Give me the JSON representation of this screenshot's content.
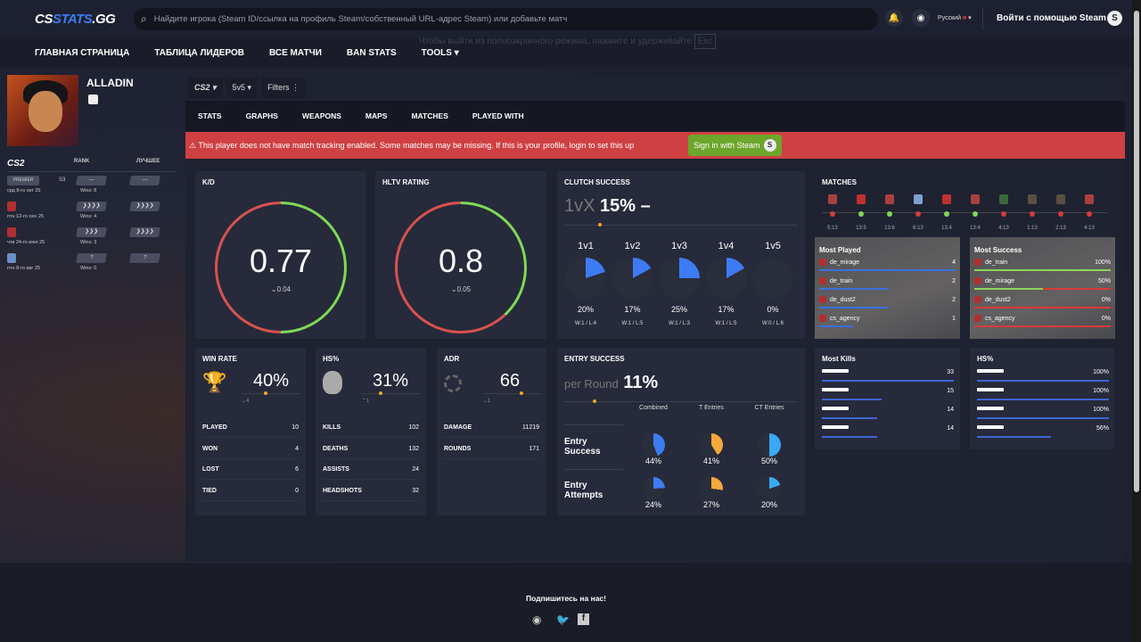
{
  "header": {
    "logo_a": "CS",
    "logo_b": "STATS",
    "logo_c": ".GG",
    "search_placeholder": "Найдите игрока (Steam ID/ссылка на профиль Steam/собственный URL-адрес Steam) или добавьте матч",
    "language": "Русский",
    "login": "Войти с помощью Steam",
    "fullscreen_msg": "Чтобы выйти из полноэкранного режима, нажмите и удерживайте",
    "esc": "Esc"
  },
  "nav": [
    "ГЛАВНАЯ СТРАНИЦА",
    "ТАБЛИЦА ЛИДЕРОВ",
    "ВСЕ МАТЧИ",
    "BAN STATS",
    "TOOLS ▾"
  ],
  "player": {
    "name": "ALLADIN"
  },
  "ranks": {
    "game": "CS2",
    "col_rank": "RANK",
    "col_best": "ЛУЧШЕЕ",
    "rows": [
      {
        "badge": "PREMIER",
        "season": "S3",
        "rank": "---",
        "best": "---",
        "date": "срд 8-го окт 25",
        "wins": "Wins: 8"
      },
      {
        "badge": "",
        "season": "",
        "rank": "❯❯❯❯",
        "best": "❯❯❯❯",
        "date": "птн 12-го сен 25",
        "wins": "Wins: 4"
      },
      {
        "badge": "",
        "season": "",
        "rank": "❯❯❯",
        "best": "❯❯❯❯",
        "date": "чтв 24-го июл 25",
        "wins": "Wins: 3"
      },
      {
        "badge": "",
        "season": "",
        "rank": "?",
        "best": "?",
        "date": "птн 8-го авг 25",
        "wins": "Wins: 0"
      }
    ]
  },
  "filters": {
    "game": "CS2 ▾",
    "mode": "5v5 ▾",
    "filters": "Filters ⋮"
  },
  "tabs": [
    "STATS",
    "GRAPHS",
    "WEAPONS",
    "MAPS",
    "MATCHES",
    "PLAYED WITH"
  ],
  "alert": {
    "text": "⚠ This player does not have match tracking enabled. Some matches may be missing. If this is your profile, login to set this up",
    "button": "Sign in with Steam"
  },
  "kd": {
    "title": "K/D",
    "value": "0.77",
    "change": "⌄0.04"
  },
  "hltv": {
    "title": "HLTV RATING",
    "value": "0.8",
    "change": "⌄0.05"
  },
  "clutch": {
    "title": "CLUTCH SUCCESS",
    "prefix": "1vX",
    "value": "15%",
    "suffix": "–",
    "items": [
      {
        "label": "1v1",
        "pct": 20,
        "pct_text": "20%",
        "wl": "W:1 / L:4"
      },
      {
        "label": "1v2",
        "pct": 17,
        "pct_text": "17%",
        "wl": "W:1 / L:5"
      },
      {
        "label": "1v3",
        "pct": 25,
        "pct_text": "25%",
        "wl": "W:1 / L:3"
      },
      {
        "label": "1v4",
        "pct": 17,
        "pct_text": "17%",
        "wl": "W:1 / L:5"
      },
      {
        "label": "1v5",
        "pct": 0,
        "pct_text": "0%",
        "wl": "W:0 / L:6"
      }
    ]
  },
  "matches": {
    "title": "MATCHES",
    "list": [
      {
        "score": "5:13",
        "win": false,
        "map": "mirage"
      },
      {
        "score": "13:5",
        "win": true,
        "map": "train"
      },
      {
        "score": "13:6",
        "win": true,
        "map": "mirage"
      },
      {
        "score": "6:13",
        "win": false,
        "map": "agency"
      },
      {
        "score": "13:4",
        "win": true,
        "map": "train"
      },
      {
        "score": "13:4",
        "win": true,
        "map": "mirage"
      },
      {
        "score": "4:13",
        "win": false,
        "map": "other"
      },
      {
        "score": "1:13",
        "win": false,
        "map": "dust2"
      },
      {
        "score": "2:13",
        "win": false,
        "map": "dust2"
      },
      {
        "score": "4:13",
        "win": false,
        "map": "mirage"
      }
    ],
    "most_played": {
      "title": "Most Played",
      "rows": [
        {
          "map": "de_mirage",
          "value": "4",
          "frac": 1
        },
        {
          "map": "de_train",
          "value": "2",
          "frac": 0.5
        },
        {
          "map": "de_dust2",
          "value": "2",
          "frac": 0.5
        },
        {
          "map": "cs_agency",
          "value": "1",
          "frac": 0.25
        }
      ]
    },
    "most_success": {
      "title": "Most Success",
      "rows": [
        {
          "map": "de_train",
          "value": "100%",
          "frac": 1
        },
        {
          "map": "de_mirage",
          "value": "50%",
          "frac": 0.5
        },
        {
          "map": "de_dust2",
          "value": "0%",
          "frac": 0
        },
        {
          "map": "cs_agency",
          "value": "0%",
          "frac": 0
        }
      ]
    }
  },
  "winrate": {
    "title": "WIN RATE",
    "value": "40%",
    "change": "⌄4",
    "rows": [
      [
        "PLAYED",
        "10"
      ],
      [
        "WON",
        "4"
      ],
      [
        "LOST",
        "6"
      ],
      [
        "TIED",
        "0"
      ]
    ]
  },
  "hs": {
    "title": "HS%",
    "value": "31%",
    "change": "⌃1",
    "rows": [
      [
        "KILLS",
        "102"
      ],
      [
        "DEATHS",
        "132"
      ],
      [
        "ASSISTS",
        "24"
      ],
      [
        "HEADSHOTS",
        "32"
      ]
    ]
  },
  "adr": {
    "title": "ADR",
    "value": "66",
    "change": "⌄1",
    "rows": [
      [
        "DAMAGE",
        "11219"
      ],
      [
        "ROUNDS",
        "171"
      ]
    ]
  },
  "entry": {
    "title": "ENTRY SUCCESS",
    "prefix": "per Round",
    "value": "11%",
    "cols": [
      "Combined",
      "T Entries",
      "CT Entries"
    ],
    "rows": [
      {
        "label": "Entry Success",
        "vals": [
          44,
          41,
          50
        ],
        "texts": [
          "44%",
          "41%",
          "50%"
        ]
      },
      {
        "label": "Entry Attempts",
        "vals": [
          24,
          27,
          20
        ],
        "texts": [
          "24%",
          "27%",
          "20%"
        ]
      }
    ],
    "colors": [
      "#3d7bf2",
      "#f5a93a",
      "#3aa8f5"
    ]
  },
  "most_kills": {
    "title": "Most Kills",
    "rows": [
      {
        "weapon": "ak47",
        "value": "33",
        "frac": 1
      },
      {
        "weapon": "awp",
        "value": "15",
        "frac": 0.45
      },
      {
        "weapon": "m4a1",
        "value": "14",
        "frac": 0.42
      },
      {
        "weapon": "galil",
        "value": "14",
        "frac": 0.42
      }
    ]
  },
  "hs_weapons": {
    "title": "HS%",
    "rows": [
      {
        "weapon": "usp",
        "value": "100%",
        "frac": 1
      },
      {
        "weapon": "dual",
        "value": "100%",
        "frac": 1
      },
      {
        "weapon": "deagle",
        "value": "100%",
        "frac": 1
      },
      {
        "weapon": "glock",
        "value": "56%",
        "frac": 0.56
      }
    ]
  },
  "footer": {
    "title": "Подпишитесь на нас!"
  },
  "colors": {
    "win": "#7ed957",
    "loss": "#d83a3a",
    "accent": "#3d7bf2",
    "alert": "#cf4042"
  }
}
